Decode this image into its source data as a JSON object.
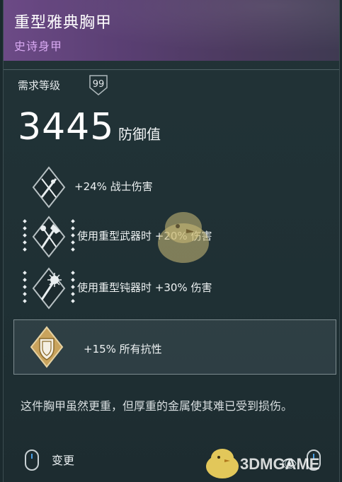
{
  "item": {
    "name": "重型雅典胸甲",
    "rarity": "史诗身甲",
    "rarity_color": "#d8a9f2"
  },
  "requirement": {
    "label": "需求等级",
    "level": "99"
  },
  "armor": {
    "value": "3445",
    "unit": "防御值"
  },
  "perks": [
    {
      "icon": "warrior-damage-icon",
      "text": "+24% 战士伤害"
    },
    {
      "icon": "heavy-weapon-icon",
      "text": "使用重型武器时 +20% 伤害"
    },
    {
      "icon": "blunt-weapon-icon",
      "text": "使用重型钝器时 +30% 伤害"
    }
  ],
  "resistance": {
    "icon": "shield-icon",
    "text": "+15% 所有抗性",
    "icon_color": "#c9a35d"
  },
  "description": "这件胸甲虽然更重，但厚重的金属使其难已受到损伤。",
  "controls": {
    "change_label": "变更"
  },
  "watermark": "3DMGAME"
}
